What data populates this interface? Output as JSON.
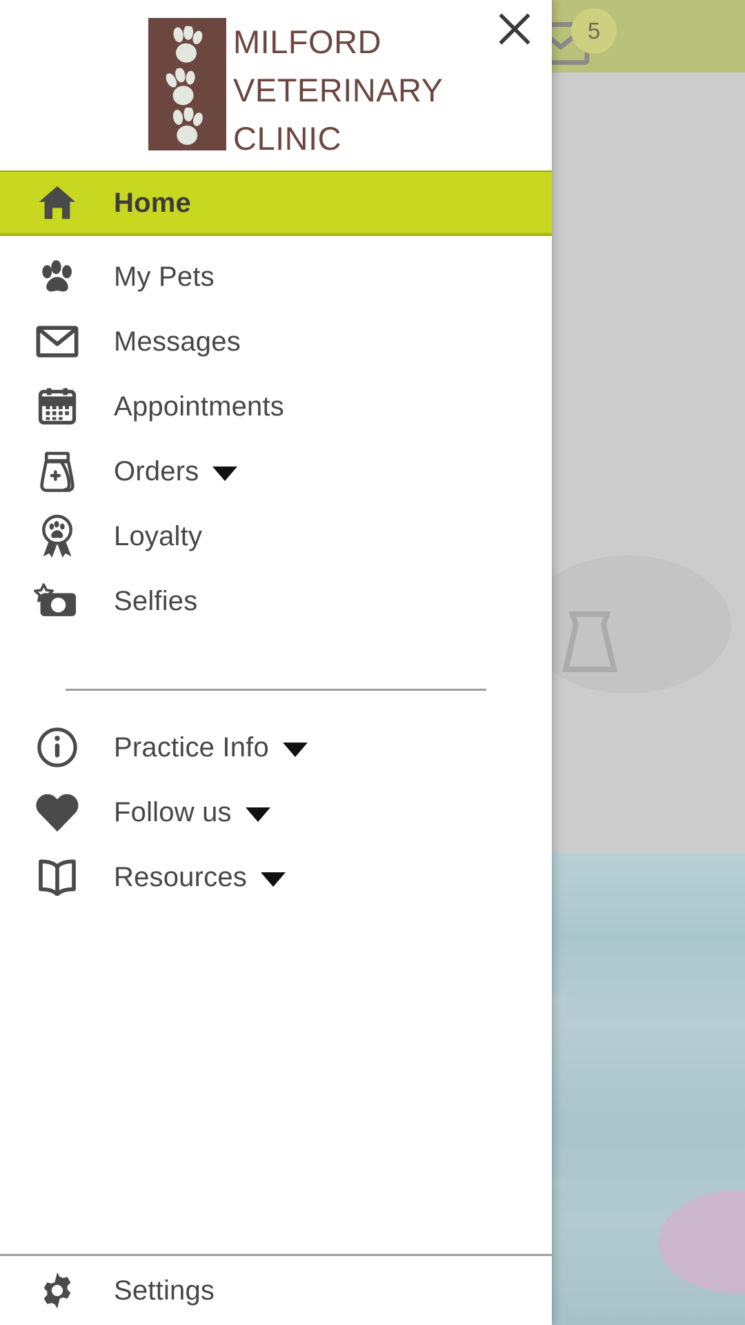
{
  "background": {
    "appbar": {
      "mail_icon": "envelope-icon",
      "badge_count": "5",
      "background_color": "#b9c17a"
    },
    "content_placeholder_icon": "food-bag-icon",
    "water_photo": "pool-water-photo"
  },
  "drawer": {
    "close_label": "✕",
    "close_icon": "close-icon",
    "logo": {
      "mark_icon": "paw-prints-logo-mark",
      "line1": "MILFORD",
      "line2": "VETERINARY",
      "line3": "CLINIC",
      "color": "#6b4740"
    },
    "active_color": "#c8d720",
    "primary_items": [
      {
        "label": "Home",
        "icon": "home-icon",
        "active": true,
        "caret": false
      },
      {
        "label": "My Pets",
        "icon": "paw-icon",
        "active": false,
        "caret": false
      },
      {
        "label": "Messages",
        "icon": "envelope-icon",
        "active": false,
        "caret": false
      },
      {
        "label": "Appointments",
        "icon": "calendar-icon",
        "active": false,
        "caret": false
      },
      {
        "label": "Orders",
        "icon": "food-bag-icon",
        "active": false,
        "caret": true
      },
      {
        "label": "Loyalty",
        "icon": "award-paw-icon",
        "active": false,
        "caret": false
      },
      {
        "label": "Selfies",
        "icon": "camera-star-icon",
        "active": false,
        "caret": false
      }
    ],
    "secondary_items": [
      {
        "label": "Practice Info",
        "icon": "info-circle-icon",
        "caret": true
      },
      {
        "label": "Follow us",
        "icon": "heart-icon",
        "caret": true
      },
      {
        "label": "Resources",
        "icon": "book-icon",
        "caret": true
      }
    ],
    "footer_items": [
      {
        "label": "Settings",
        "icon": "gear-icon"
      }
    ]
  }
}
